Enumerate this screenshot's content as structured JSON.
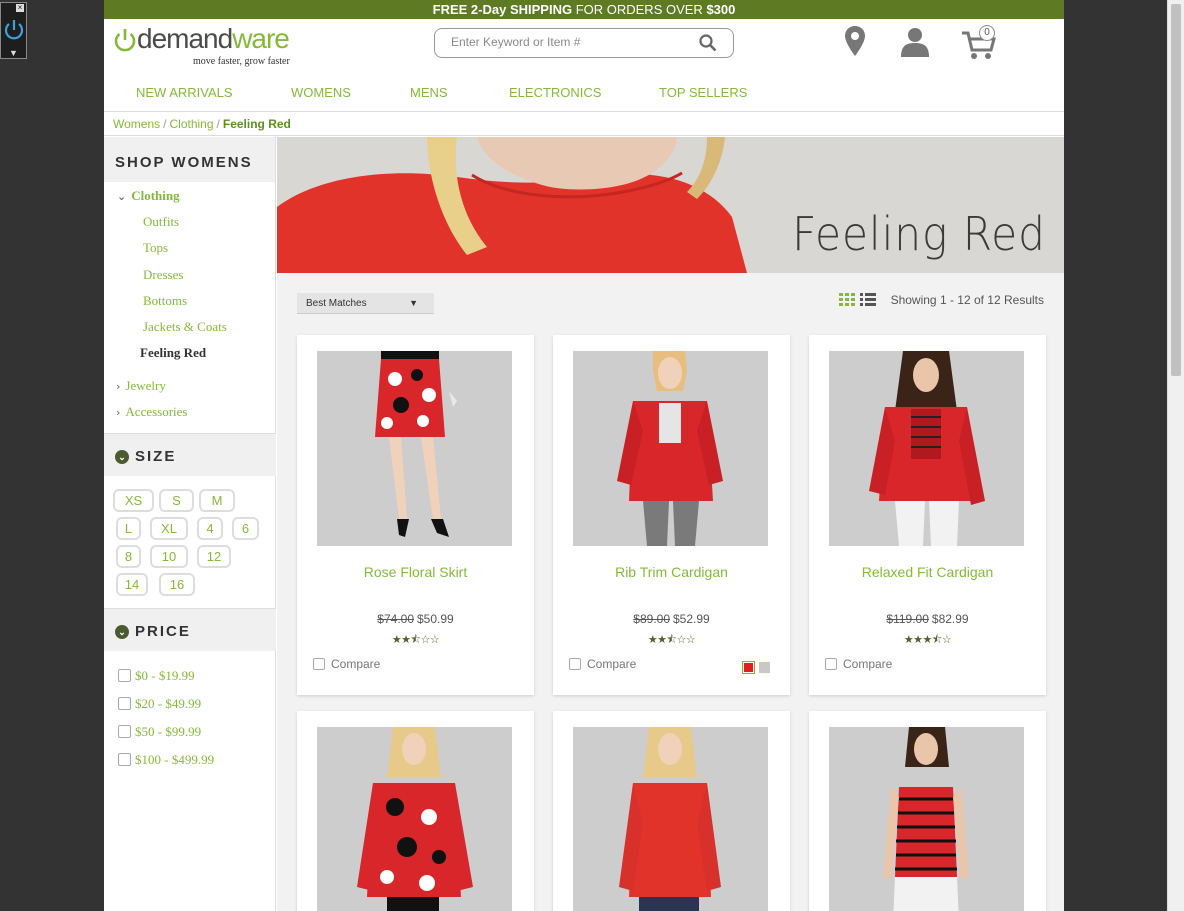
{
  "promo": {
    "bold1": "FREE 2-Day ",
    "bold2": "SHIPPING",
    "rest": " FOR ORDERS OVER ",
    "amount": "$300"
  },
  "logo": {
    "pre": "",
    "accent": "demand",
    "word": "ware",
    "tagline": "move faster, grow faster"
  },
  "search": {
    "placeholder": "Enter Keyword or Item #"
  },
  "cart": {
    "count": "0"
  },
  "nav": [
    "NEW ARRIVALS",
    "WOMENS",
    "MENS",
    "ELECTRONICS",
    "TOP SELLERS"
  ],
  "breadcrumb": {
    "items": [
      "Womens",
      "Clothing"
    ],
    "current": "Feeling Red",
    "separator": "/"
  },
  "sidebar": {
    "heading": "SHOP WOMENS",
    "clothing": "Clothing",
    "subcategories": [
      "Outfits",
      "Tops",
      "Dresses",
      "Bottoms",
      "Jackets & Coats"
    ],
    "active": "Feeling Red",
    "other": [
      "Jewelry",
      "Accessories"
    ],
    "size_heading": "SIZE",
    "sizes": [
      "XS",
      "S",
      "M",
      "L",
      "XL",
      "4",
      "6",
      "8",
      "10",
      "12",
      "14",
      "16"
    ],
    "price_heading": "PRICE",
    "prices": [
      "$0 - $19.99",
      "$20 - $49.99",
      "$50 - $99.99",
      "$100 - $499.99"
    ]
  },
  "banner": {
    "title": "Feeling Red"
  },
  "sort": {
    "selected": "Best Matches"
  },
  "results": "Showing 1 - 12 of 12 Results",
  "compare_label": "Compare",
  "products": [
    {
      "name": "Rose Floral Skirt",
      "old_price": "$74.00",
      "price": "$50.99",
      "rating": 2.5
    },
    {
      "name": "Rib Trim Cardigan",
      "old_price": "$89.00",
      "price": "$52.99",
      "rating": 2.5
    },
    {
      "name": "Relaxed Fit Cardigan",
      "old_price": "$119.00",
      "price": "$82.99",
      "rating": 3.5
    },
    {
      "name": "",
      "old_price": "",
      "price": "",
      "rating": 0
    },
    {
      "name": "",
      "old_price": "",
      "price": "",
      "rating": 0
    },
    {
      "name": "",
      "old_price": "",
      "price": "",
      "rating": 0
    }
  ],
  "colors": {
    "brand_green": "#86b93a",
    "promo_bg": "#5e7b24",
    "swatch_red": "#e02020",
    "swatch_gray": "#c8c8c8"
  }
}
